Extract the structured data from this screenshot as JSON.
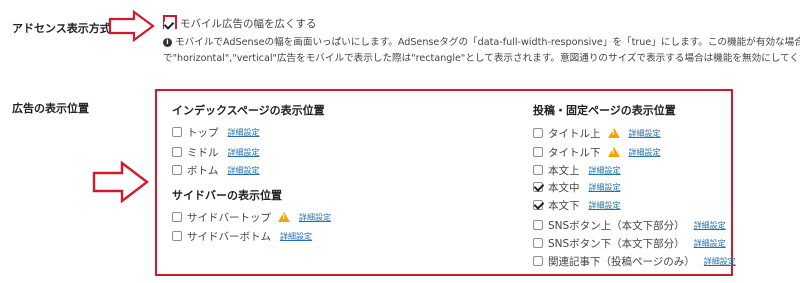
{
  "settings": {
    "adsense_label": "アドセンス表示方式",
    "mobile_option_label": "モバイル広告の幅を広くする",
    "mobile_option_checked": true,
    "desc_line1": "モバイルでAdSenseの幅を画面いっぱいにします。AdSenseタグの「data-full-width-responsive」を「true」にします。この機能が有効な場合、",
    "desc_line2": "で\"horizontal\",\"vertical\"広告をモバイルで表示した際は\"rectangle\"として表示されます。意図通りのサイズで表示する場合は機能を無効にしてくだ",
    "ad_position_label": "広告の表示位置"
  },
  "index_page": {
    "heading": "インデックスページの表示位置",
    "items": [
      {
        "label": "トップ",
        "checked": false,
        "warn": false,
        "link": "詳細設定"
      },
      {
        "label": "ミドル",
        "checked": false,
        "warn": false,
        "link": "詳細設定"
      },
      {
        "label": "ボトム",
        "checked": false,
        "warn": false,
        "link": "詳細設定"
      }
    ]
  },
  "sidebar": {
    "heading": "サイドバーの表示位置",
    "items": [
      {
        "label": "サイドバートップ",
        "checked": false,
        "warn": true,
        "link": "詳細設定"
      },
      {
        "label": "サイドバーボトム",
        "checked": false,
        "warn": false,
        "link": "詳細設定"
      }
    ]
  },
  "post_page": {
    "heading": "投稿・固定ページの表示位置",
    "items": [
      {
        "label": "タイトル上",
        "checked": false,
        "warn": true,
        "link": "詳細設定"
      },
      {
        "label": "タイトル下",
        "checked": false,
        "warn": true,
        "link": "詳細設定"
      },
      {
        "label": "本文上",
        "checked": false,
        "warn": false,
        "link": "詳細設定"
      },
      {
        "label": "本文中",
        "checked": true,
        "warn": false,
        "link": "詳細設定"
      },
      {
        "label": "本文下",
        "checked": true,
        "warn": false,
        "link": "詳細設定"
      },
      {
        "label": "SNSボタン上（本文下部分）",
        "checked": false,
        "warn": false,
        "link": "詳細設定"
      },
      {
        "label": "SNSボタン下（本文下部分）",
        "checked": false,
        "warn": false,
        "link": "詳細設定"
      },
      {
        "label": "関連記事下（投稿ページのみ）",
        "checked": false,
        "warn": false,
        "link": "詳細設定"
      }
    ]
  },
  "colors": {
    "highlight_red": "#d01c2a",
    "link_blue": "#2271b1",
    "warning_orange": "#f0a500"
  }
}
